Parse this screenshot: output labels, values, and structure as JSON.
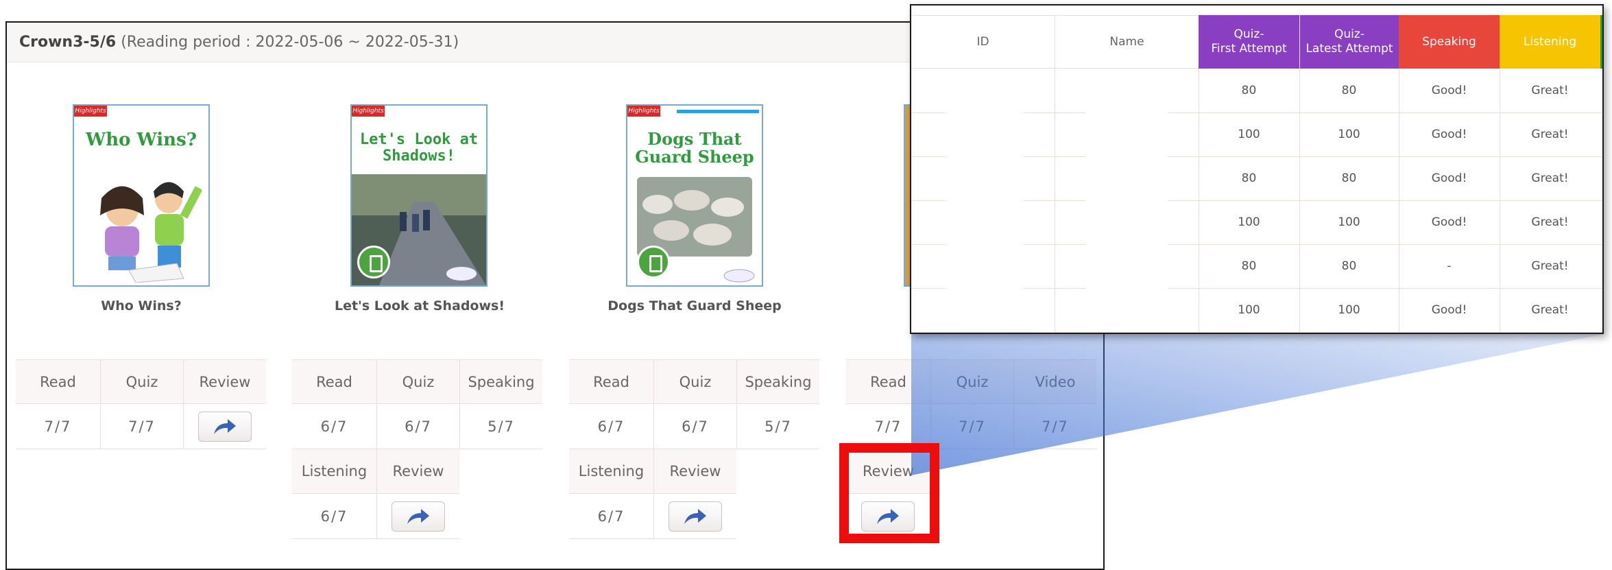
{
  "header": {
    "class_name": "Crown3-5/6",
    "period": "(Reading period : 2022-05-06 ~ 2022-05-31)"
  },
  "books": [
    {
      "cover_title": "Who Wins?",
      "title": "Who Wins?",
      "stats": [
        {
          "label": "Read",
          "value": "7/7"
        },
        {
          "label": "Quiz",
          "value": "7/7"
        },
        {
          "label": "Review",
          "value": ""
        }
      ]
    },
    {
      "cover_title": "Let's Look at Shadows!",
      "title": "Let's Look at Shadows!",
      "stats": [
        {
          "label": "Read",
          "value": "6/7"
        },
        {
          "label": "Quiz",
          "value": "6/7"
        },
        {
          "label": "Speaking",
          "value": "5/7"
        },
        {
          "label": "Listening",
          "value": "6/7"
        },
        {
          "label": "Review",
          "value": ""
        }
      ]
    },
    {
      "cover_title": "Dogs That Guard Sheep",
      "title": "Dogs That Guard Sheep",
      "stats": [
        {
          "label": "Read",
          "value": "6/7"
        },
        {
          "label": "Quiz",
          "value": "6/7"
        },
        {
          "label": "Speaking",
          "value": "5/7"
        },
        {
          "label": "Listening",
          "value": "6/7"
        },
        {
          "label": "Review",
          "value": ""
        }
      ]
    },
    {
      "cover_title": "",
      "title": "",
      "stats": [
        {
          "label": "Read",
          "value": "7/7"
        },
        {
          "label": "Quiz",
          "value": "7/7"
        },
        {
          "label": "Video",
          "value": "7/7"
        },
        {
          "label": "Review",
          "value": ""
        }
      ]
    }
  ],
  "brand_label": "Highlights",
  "zoom_table": {
    "headers": {
      "id": "ID",
      "name": "Name",
      "quiz_first_1": "Quiz-",
      "quiz_first_2": "First Attempt",
      "quiz_latest_1": "Quiz-",
      "quiz_latest_2": "Latest Attempt",
      "speaking": "Speaking",
      "listening": "Listening"
    },
    "header_colors": {
      "quiz": "#8a3fc2",
      "speaking": "#e8463a",
      "listening": "#f6c400",
      "edge": "#1f9d4a"
    },
    "rows": [
      {
        "id": "",
        "name": "",
        "quiz_first": "80",
        "quiz_latest": "80",
        "speaking": "Good!",
        "listening": "Great!"
      },
      {
        "id": "",
        "name": "",
        "quiz_first": "100",
        "quiz_latest": "100",
        "speaking": "Good!",
        "listening": "Great!"
      },
      {
        "id": "",
        "name": "",
        "quiz_first": "80",
        "quiz_latest": "80",
        "speaking": "Good!",
        "listening": "Great!"
      },
      {
        "id": "",
        "name": "",
        "quiz_first": "100",
        "quiz_latest": "100",
        "speaking": "Good!",
        "listening": "Great!"
      },
      {
        "id": "",
        "name": "",
        "quiz_first": "80",
        "quiz_latest": "80",
        "speaking": "-",
        "listening": "Great!"
      },
      {
        "id": "",
        "name": "",
        "quiz_first": "100",
        "quiz_latest": "100",
        "speaking": "Good!",
        "listening": "Great!"
      }
    ]
  },
  "icons": {
    "review": "share-arrow-icon",
    "ebook": "ebook-badge-icon"
  },
  "colors": {
    "highlight": "#ee0d0d",
    "funnel": "#5b86d8",
    "cover_title": "#2e9b3c"
  }
}
